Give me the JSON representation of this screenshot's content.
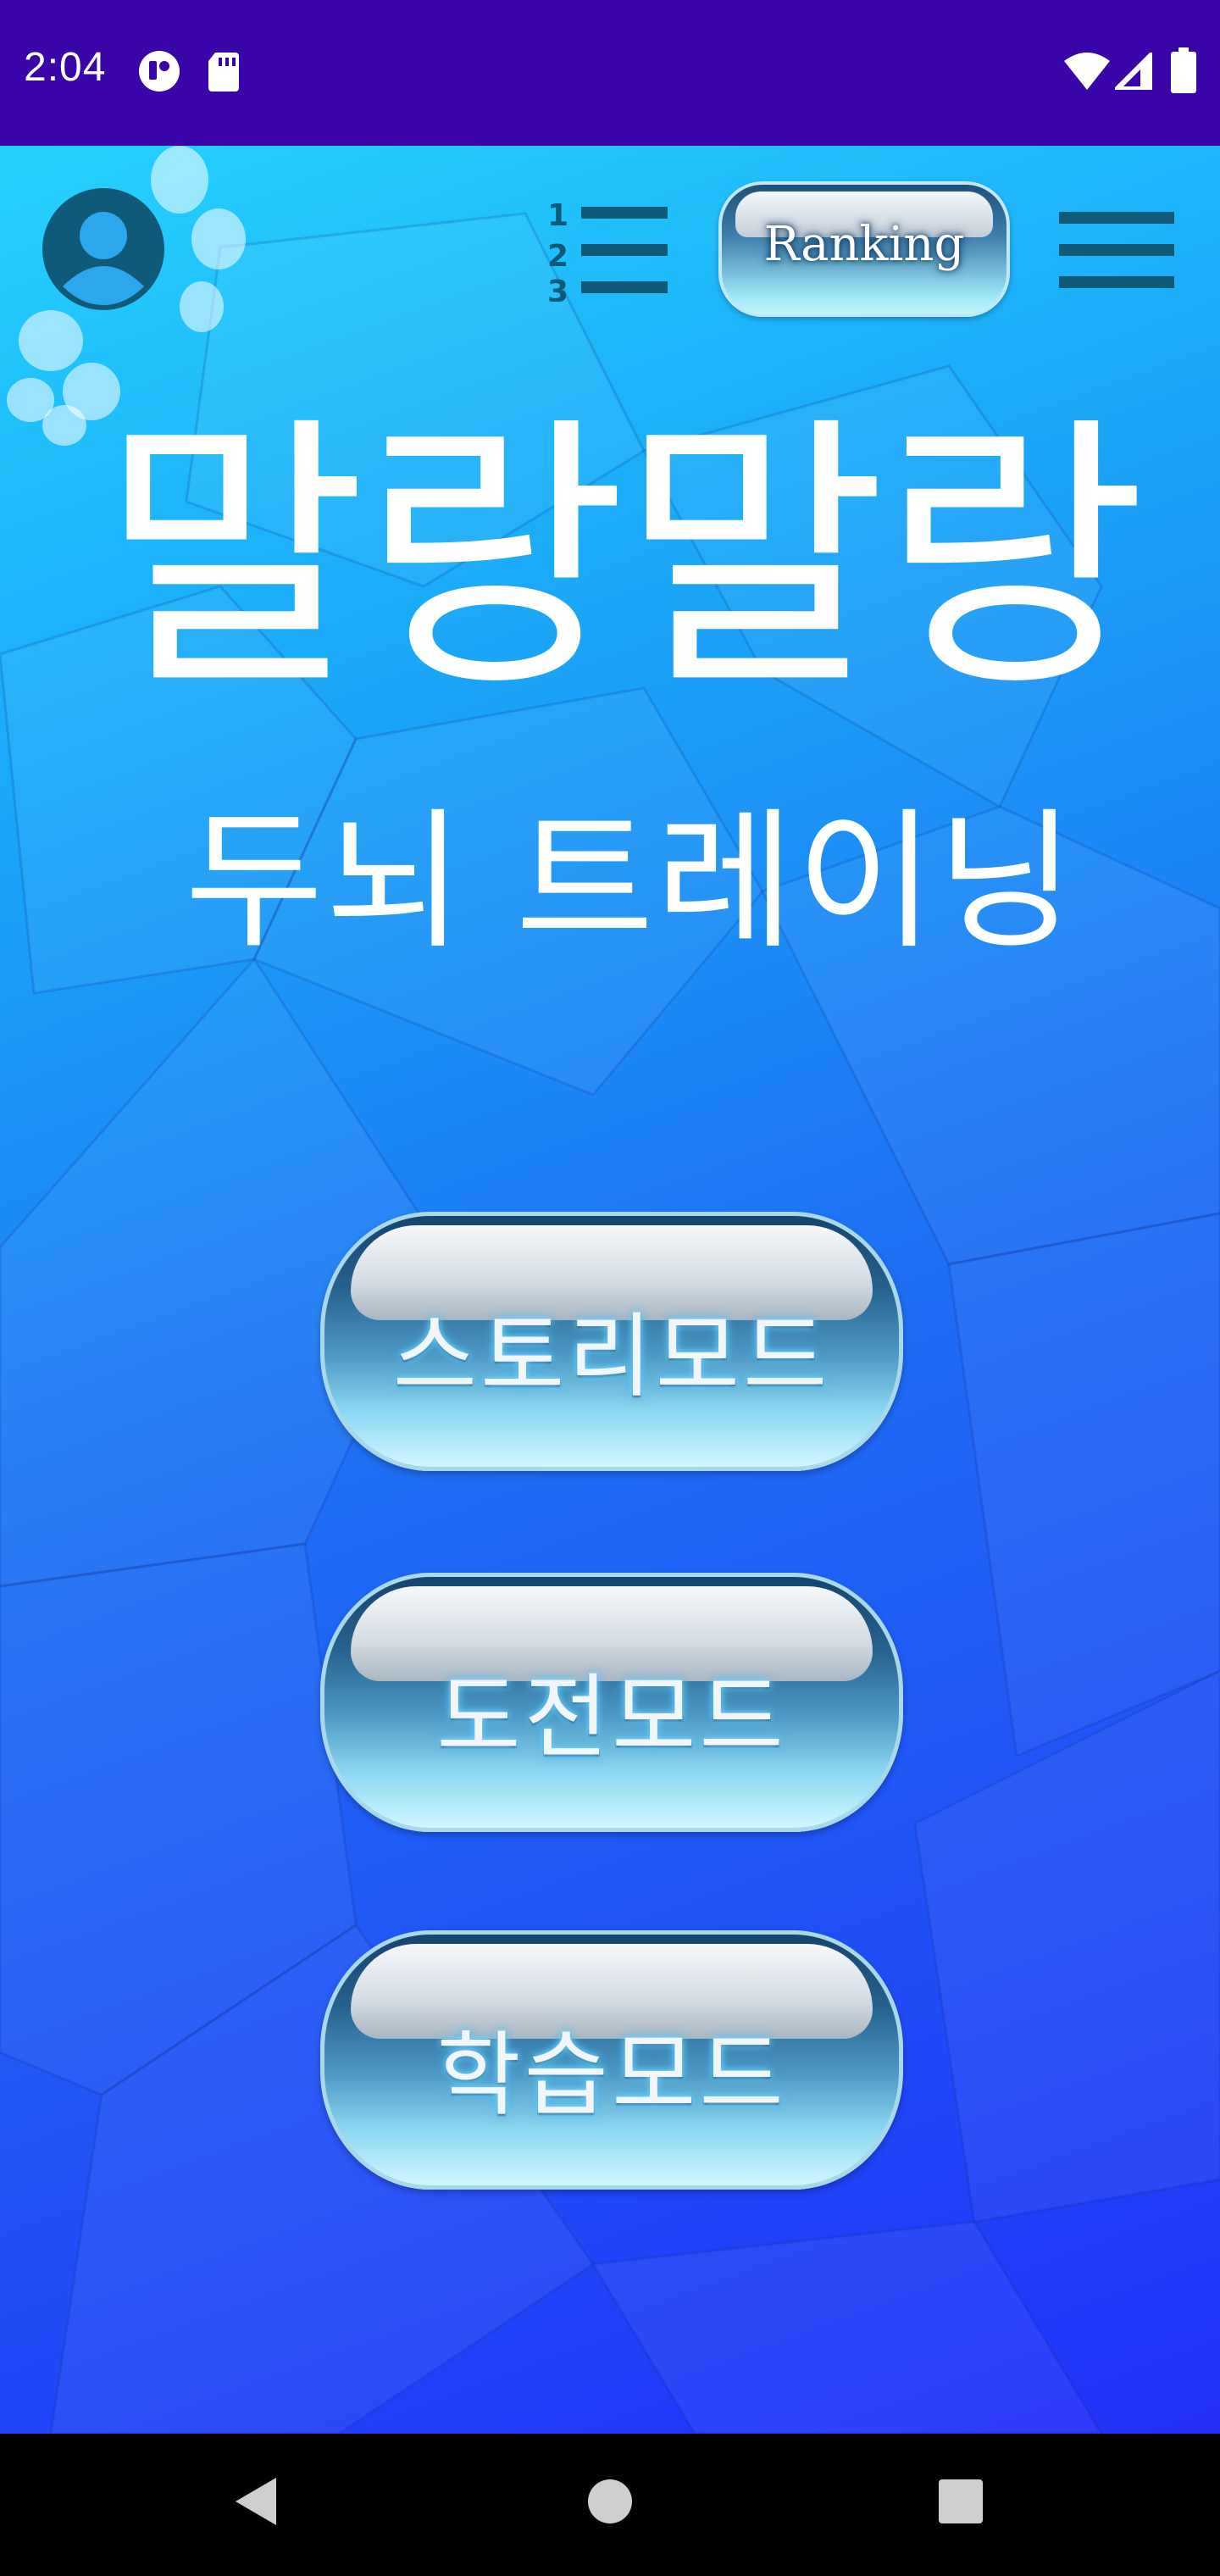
{
  "status_bar": {
    "time": "2:04",
    "left_icons": [
      "notification-app-icon",
      "sd-card-icon"
    ],
    "right_icons": [
      "wifi-icon",
      "cellular-signal-icon",
      "battery-icon"
    ]
  },
  "header": {
    "avatar_icon": "person-avatar-icon",
    "rank_list_icon": "numbered-list-icon",
    "ranking_label": "Ranking",
    "menu_icon": "hamburger-menu-icon"
  },
  "title": {
    "main": "말랑말랑",
    "sub": "두뇌 트레이닝"
  },
  "modes": {
    "story": "스토리모드",
    "challenge": "도전모드",
    "study": "학습모드"
  },
  "nav_bar": {
    "icons": [
      "back-icon",
      "home-icon",
      "recents-icon"
    ]
  },
  "colors": {
    "status_bar": "#3a05a8",
    "background_top": "#25d2ff",
    "background_bottom": "#2330f8",
    "icon_dark": "#0f5a78",
    "button_dark": "#14436b"
  }
}
